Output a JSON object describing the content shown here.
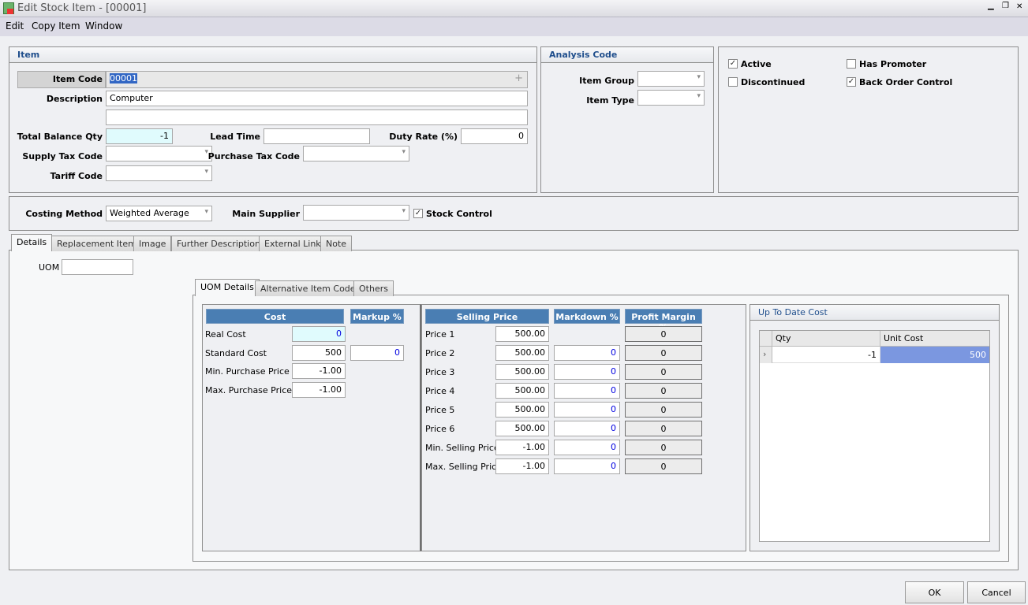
{
  "window": {
    "title": "Edit Stock Item - [00001]",
    "controls": [
      "minimize",
      "restore",
      "close"
    ]
  },
  "menu": [
    "Edit",
    "Copy Item",
    "Window"
  ],
  "item": {
    "header": "Item",
    "item_code_label": "Item Code",
    "item_code": "00001",
    "description_label": "Description",
    "description": "Computer",
    "description2": "",
    "total_balance_qty_label": "Total Balance Qty",
    "total_balance_qty": "-1",
    "lead_time_label": "Lead Time",
    "lead_time": "",
    "duty_rate_label": "Duty Rate (%)",
    "duty_rate": "0",
    "supply_tax_label": "Supply Tax Code",
    "supply_tax": "",
    "purchase_tax_label": "Purchase Tax Code",
    "purchase_tax": "",
    "tariff_label": "Tariff Code",
    "tariff": ""
  },
  "analysis": {
    "header": "Analysis Code",
    "item_group_label": "Item Group",
    "item_group": "",
    "item_type_label": "Item Type",
    "item_type": ""
  },
  "flags": {
    "active": {
      "label": "Active",
      "checked": true
    },
    "discontinued": {
      "label": "Discontinued",
      "checked": false
    },
    "has_promoter": {
      "label": "Has Promoter",
      "checked": false
    },
    "back_order": {
      "label": "Back Order Control",
      "checked": true
    }
  },
  "costing": {
    "method_label": "Costing Method",
    "method": "Weighted Average",
    "supplier_label": "Main Supplier",
    "supplier": "",
    "stock_control_label": "Stock Control",
    "stock_control": true
  },
  "tabs": [
    "Details",
    "Replacement Item",
    "Image",
    "Further Description",
    "External Link",
    "Note"
  ],
  "uom": {
    "label": "UOM",
    "value": ""
  },
  "inner_tabs": [
    "UOM Details",
    "Alternative Item Code",
    "Others"
  ],
  "cost": {
    "header": "Cost",
    "markup_header": "Markup %",
    "rows": [
      {
        "label": "Real Cost",
        "value": "0"
      },
      {
        "label": "Standard Cost",
        "value": "500",
        "markup": "0"
      },
      {
        "label": "Min. Purchase Price",
        "value": "-1.00"
      },
      {
        "label": "Max. Purchase Price",
        "value": "-1.00"
      }
    ]
  },
  "selling": {
    "header": "Selling Price",
    "markdown_header": "Markdown %",
    "margin_header": "Profit Margin %",
    "rows": [
      {
        "label": "Price 1",
        "price": "500.00",
        "markdown": null,
        "margin": "0"
      },
      {
        "label": "Price 2",
        "price": "500.00",
        "markdown": "0",
        "margin": "0"
      },
      {
        "label": "Price 3",
        "price": "500.00",
        "markdown": "0",
        "margin": "0"
      },
      {
        "label": "Price 4",
        "price": "500.00",
        "markdown": "0",
        "margin": "0"
      },
      {
        "label": "Price 5",
        "price": "500.00",
        "markdown": "0",
        "margin": "0"
      },
      {
        "label": "Price 6",
        "price": "500.00",
        "markdown": "0",
        "margin": "0"
      },
      {
        "label": "Min. Selling Price",
        "price": "-1.00",
        "markdown": "0",
        "margin": "0"
      },
      {
        "label": "Max. Selling Price",
        "price": "-1.00",
        "markdown": "0",
        "margin": "0"
      }
    ]
  },
  "up_to_date_cost": {
    "header": "Up To Date Cost",
    "columns": [
      "Qty",
      "Unit Cost"
    ],
    "rows": [
      {
        "qty": "-1",
        "unit_cost": "500"
      }
    ]
  },
  "buttons": {
    "ok": "OK",
    "cancel": "Cancel"
  }
}
